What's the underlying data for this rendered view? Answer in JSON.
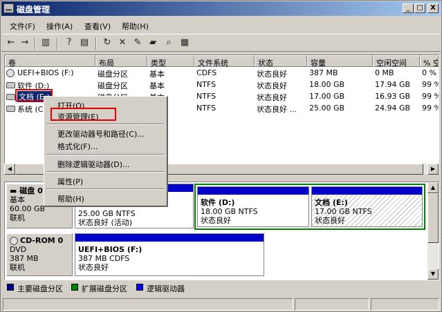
{
  "window": {
    "title": "磁盘管理",
    "minimize": "_",
    "maximize": "□",
    "close": "X"
  },
  "menubar": [
    "文件(F)",
    "操作(A)",
    "查看(V)",
    "帮助(H)"
  ],
  "toolbar": [
    "back-icon",
    "forward-icon",
    "show-hide-icon",
    "help-icon",
    "properties-icon",
    "refresh-icon",
    "delete-icon",
    "settings-icon",
    "open-icon",
    "search-icon",
    "rescan-icon"
  ],
  "columns": [
    "卷",
    "布局",
    "类型",
    "文件系统",
    "状态",
    "容量",
    "空闲空间",
    "% 空"
  ],
  "volumes": [
    [
      "UEFI+BIOS (F:)",
      "磁盘分区",
      "基本",
      "CDFS",
      "状态良好",
      "387 MB",
      "0 MB",
      "0 %"
    ],
    [
      "软件 (D:)",
      "磁盘分区",
      "基本",
      "NTFS",
      "状态良好",
      "18.00 GB",
      "17.94 GB",
      "99 %"
    ],
    [
      "文档 (E:)",
      "磁盘分区",
      "基本",
      "NTFS",
      "状态良好",
      "17.00 GB",
      "16.93 GB",
      "99 %"
    ],
    [
      "系统 (C",
      "",
      "",
      "NTFS",
      "状态良好 ...",
      "25.00 GB",
      "24.94 GB",
      "99 %"
    ]
  ],
  "context_menu": {
    "open": "打开(O)",
    "explore": "资源管理(E)",
    "change_letter": "更改驱动器号和路径(C)...",
    "format": "格式化(F)...",
    "delete": "删除逻辑驱动器(D)...",
    "properties": "属性(P)",
    "help": "帮助(H)"
  },
  "disks": [
    {
      "name": "磁盘 0",
      "type": "基本",
      "size": "60.00 GB",
      "status": "联机",
      "partitions": [
        {
          "line1": "25.00 GB NTFS",
          "line2": "状态良好 (活动)"
        },
        {
          "name": "软件 (D:)",
          "line1": "18.00 GB NTFS",
          "line2": "状态良好"
        },
        {
          "name": "文档 (E:)",
          "line1": "17.00 GB NTFS",
          "line2": "状态良好"
        }
      ]
    },
    {
      "name": "CD-ROM 0",
      "type": "DVD",
      "size": "387 MB",
      "status": "联机",
      "partitions": [
        {
          "name": "UEFI+BIOS (F:)",
          "line1": "387 MB CDFS",
          "line2": "状态良好"
        }
      ]
    }
  ],
  "legend": [
    {
      "label": "主要磁盘分区",
      "color": "#00008b"
    },
    {
      "label": "扩展磁盘分区",
      "color": "#008000"
    },
    {
      "label": "逻辑驱动器",
      "color": "#0000ff"
    }
  ]
}
